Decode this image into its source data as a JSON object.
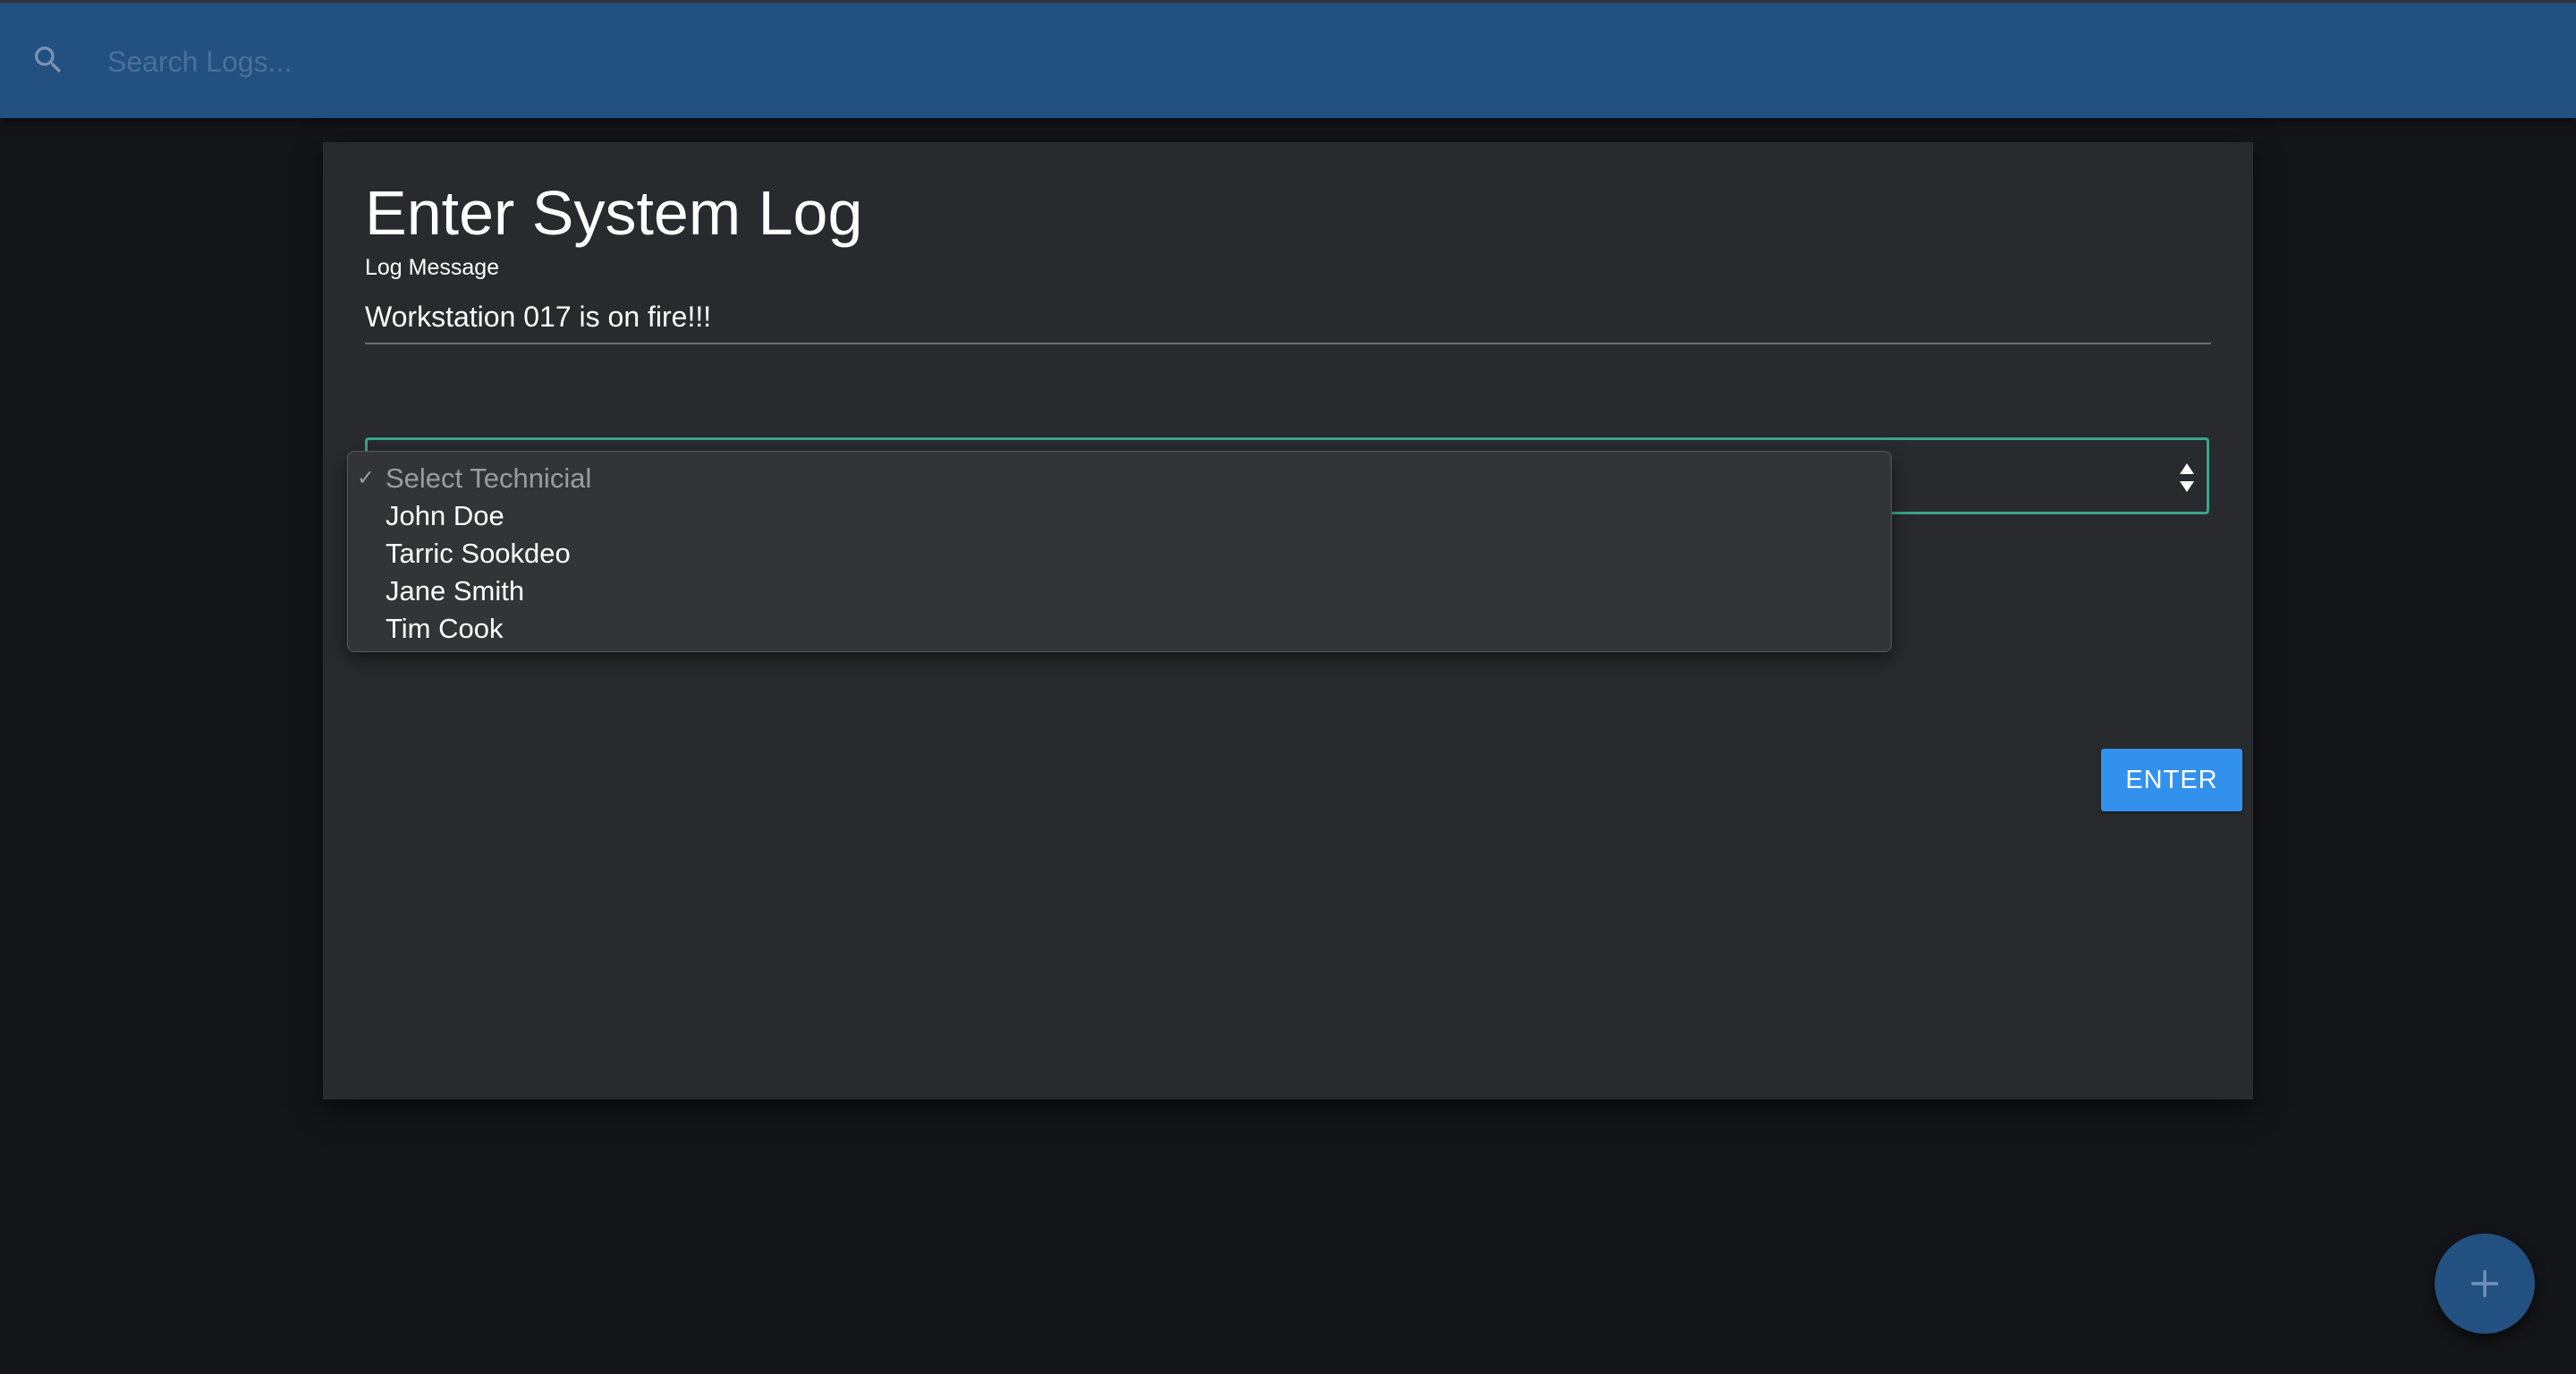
{
  "navbar": {
    "search_placeholder": "Search Logs...",
    "search_icon": "search-icon"
  },
  "modal": {
    "title": "Enter System Log",
    "message_label": "Log Message",
    "message_value": "Workstation 017 is on fire!!!",
    "technician_select": {
      "selected": "Select Technicial",
      "options": [
        "Select Technicial",
        "John Doe",
        "Tarric Sookdeo",
        "Jane Smith",
        "Tim Cook"
      ]
    },
    "submit_label": "ENTER"
  },
  "fab": {
    "icon": "plus-icon"
  },
  "colors": {
    "navbar": "#225080",
    "background": "#131518",
    "modal": "#282a2d",
    "select_border": "#39a58c",
    "button": "#3391ee"
  }
}
